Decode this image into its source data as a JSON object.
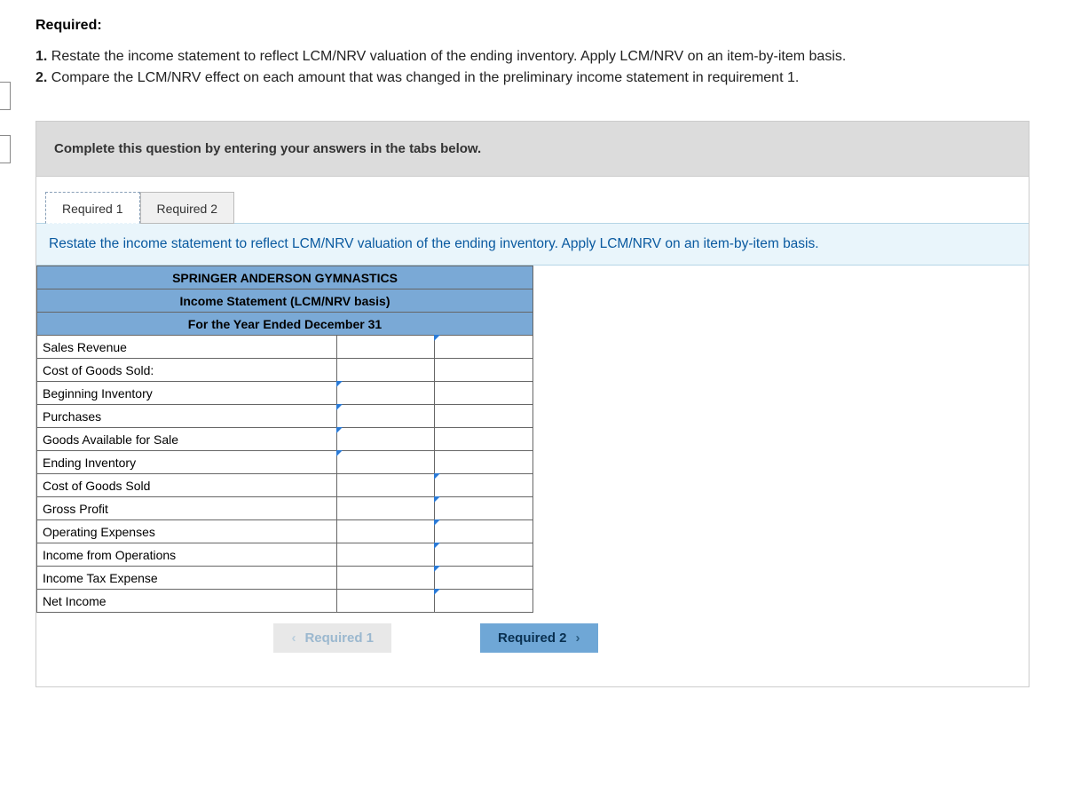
{
  "header": {
    "required_label": "Required:",
    "q1_num": "1.",
    "q1_text": " Restate the income statement to reflect LCM/NRV valuation of the ending inventory. Apply LCM/NRV on an item-by-item basis.",
    "q2_num": "2.",
    "q2_text": " Compare the LCM/NRV effect on each amount that was changed in the preliminary income statement in requirement 1."
  },
  "panel": {
    "instruction": "Complete this question by entering your answers in the tabs below.",
    "tabs": [
      {
        "label": "Required 1"
      },
      {
        "label": "Required 2"
      }
    ],
    "active_tab": 0,
    "prompt": "Restate the income statement to reflect LCM/NRV valuation of the ending inventory. Apply LCM/NRV on an item-by-item basis."
  },
  "statement": {
    "title1": "SPRINGER ANDERSON GYMNASTICS",
    "title2": "Income Statement (LCM/NRV basis)",
    "title3": "For the Year Ended December 31",
    "rows": [
      {
        "label": "Sales Revenue",
        "indent": 0,
        "col_b": "",
        "col_c_flag": true
      },
      {
        "label": "Cost of Goods Sold:",
        "indent": 0
      },
      {
        "label": "Beginning Inventory",
        "indent": 1,
        "col_b_flag": true
      },
      {
        "label": "Purchases",
        "indent": 1,
        "col_b_flag": true
      },
      {
        "label": "Goods Available for Sale",
        "indent": 2,
        "col_b_flag": true
      },
      {
        "label": "Ending Inventory",
        "indent": 1,
        "col_b_flag": true
      },
      {
        "label": "Cost of Goods Sold",
        "indent": 2,
        "col_c_flag": true
      },
      {
        "label": "Gross Profit",
        "indent": 0,
        "col_c_flag": true
      },
      {
        "label": "Operating Expenses",
        "indent": 0,
        "col_c_flag": true
      },
      {
        "label": "Income from Operations",
        "indent": 0,
        "col_c_flag": true
      },
      {
        "label": "Income Tax Expense",
        "indent": 0,
        "col_c_flag": true
      },
      {
        "label": "Net Income",
        "indent": 0,
        "col_c_flag": true
      }
    ]
  },
  "nav": {
    "prev": "Required 1",
    "next": "Required 2"
  }
}
